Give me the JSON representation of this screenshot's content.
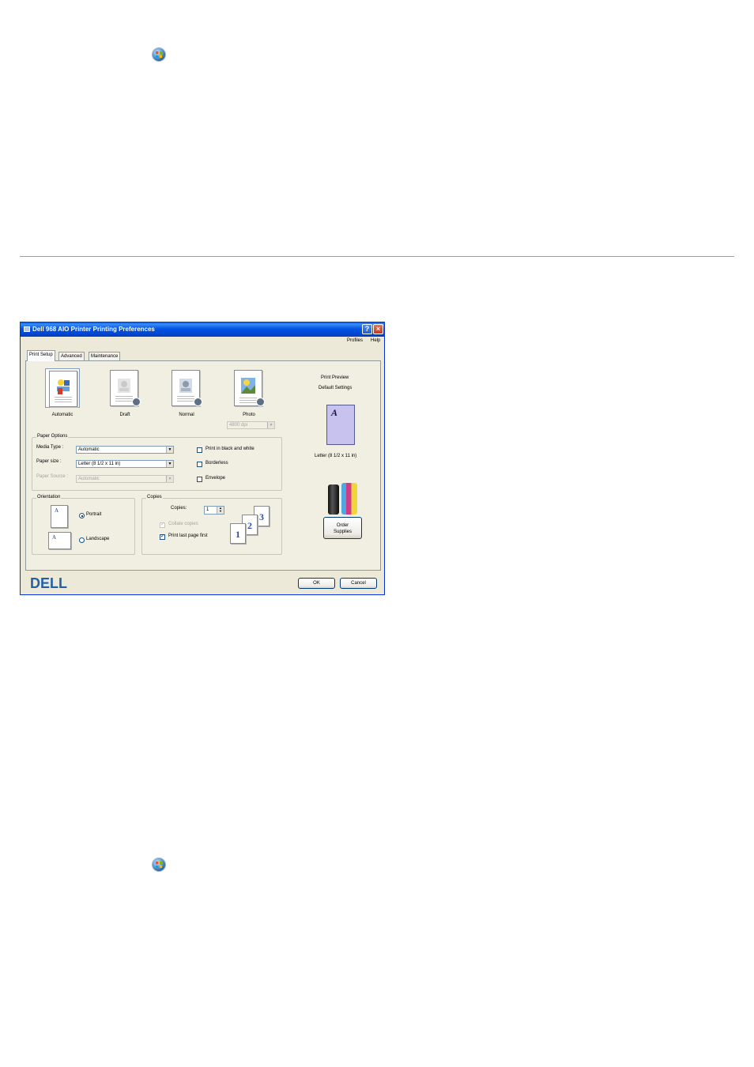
{
  "dialog": {
    "title": "Dell 968 AIO Printer Printing Preferences",
    "title_buttons": {
      "help": "?",
      "close": "×"
    },
    "menu": {
      "profiles": "Profiles",
      "help": "Help"
    },
    "tabs": [
      {
        "label": "Print Setup",
        "active": true
      },
      {
        "label": "Advanced",
        "active": false
      },
      {
        "label": "Maintenance",
        "active": false
      }
    ],
    "quality_modes": [
      {
        "label": "Automatic",
        "icon": "automatic-quality-icon",
        "selected": true
      },
      {
        "label": "Draft",
        "icon": "draft-quality-icon",
        "selected": false
      },
      {
        "label": "Normal",
        "icon": "normal-quality-icon",
        "selected": false
      },
      {
        "label": "Photo",
        "icon": "photo-quality-icon",
        "selected": false
      }
    ],
    "photo_dpi": {
      "value": "4800 dpi",
      "disabled": true
    },
    "paper_options": {
      "title": "Paper Options",
      "media_type": {
        "label": "Media Type :",
        "value": "Automatic"
      },
      "paper_size": {
        "label": "Paper size :",
        "value": "Letter (8 1/2 x 11 in)"
      },
      "paper_source": {
        "label": "Paper Source :",
        "value": "Automatic",
        "disabled": true
      },
      "checkboxes": [
        {
          "label": "Print in black and white",
          "checked": false
        },
        {
          "label": "Borderless",
          "checked": false
        },
        {
          "label": "Envelope",
          "checked": false
        }
      ]
    },
    "orientation": {
      "title": "Orientation",
      "page_glyph": "A",
      "options": [
        {
          "label": "Portrait",
          "selected": true
        },
        {
          "label": "Landscape",
          "selected": false
        }
      ]
    },
    "copies": {
      "title": "Copies",
      "label": "Copies:",
      "value": "1",
      "collate": {
        "label": "Collate copies",
        "checked": true,
        "disabled": true
      },
      "last_page_first": {
        "label": "Print last page first",
        "checked": true
      },
      "page_numbers": [
        "1",
        "2",
        "3"
      ]
    },
    "preview": {
      "title": "Print Preview",
      "subtitle": "Default Settings",
      "page_glyph": "A",
      "paper": "Letter (8 1/2 x 11 in)"
    },
    "order_supplies": {
      "label_line1": "Order",
      "label_line2": "Supplies"
    },
    "footer": {
      "brand": "DELL",
      "ok": "OK",
      "cancel": "Cancel"
    },
    "colors": {
      "titlebar": "#0054e3",
      "dialog_bg": "#ece9d8",
      "preview_page": "#c7c2ee",
      "dell_blue": "#2161a8"
    }
  }
}
